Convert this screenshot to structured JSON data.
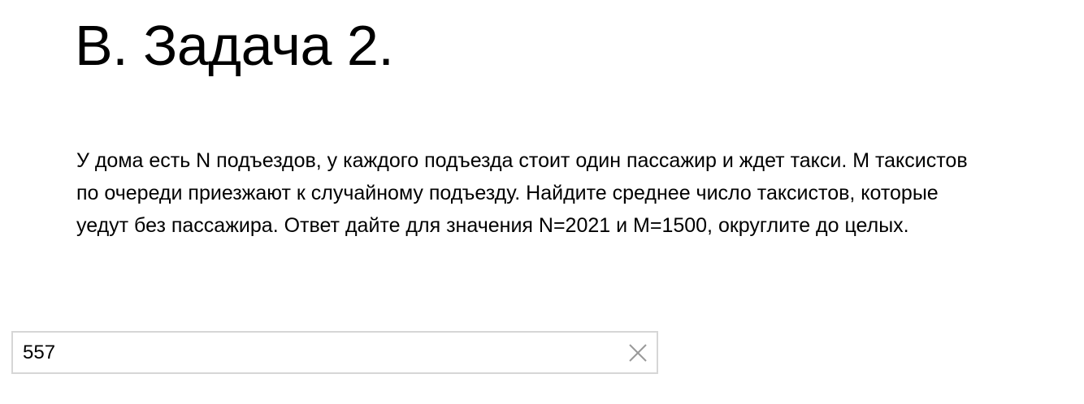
{
  "header": {
    "title": "B. Задача 2."
  },
  "problem": {
    "lines": [
      "У дома есть N подъездов, у каждого подъезда стоит один пассажир и ждет такси. M таксистов",
      "по очереди приезжают к случайному подъезду. Найдите среднее число таксистов, которые",
      "уедут без пассажира. Ответ дайте для значения N=2021 и M=1500, округлите до целых."
    ]
  },
  "answer": {
    "value": "557"
  },
  "icons": {
    "clear": "close-icon"
  },
  "colors": {
    "input_border": "#d6d6d6",
    "clear_icon": "#9a9a9a"
  }
}
